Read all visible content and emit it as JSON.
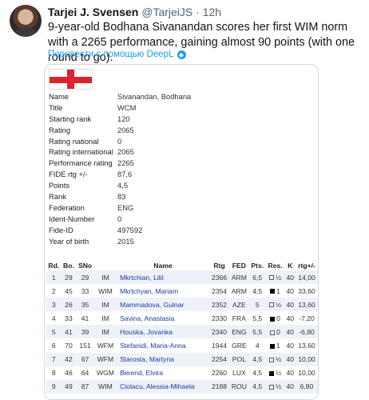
{
  "author": {
    "name": "Tarjei J. Svensen",
    "handle": "@TarjeiJS",
    "separator": "·",
    "time": "12h"
  },
  "tweet_text": "9-year-old Bodhana Sivanandan scores her first WIM norm with a 2265 performance, gaining almost 90 points (with one round to go).",
  "translate_label": "Перевести с помощью DeepL",
  "player_info": [
    {
      "label": "Name",
      "value": "Sivanandan, Bodhana"
    },
    {
      "label": "Title",
      "value": "WCM"
    },
    {
      "label": "Starting rank",
      "value": "120"
    },
    {
      "label": "Rating",
      "value": "2065"
    },
    {
      "label": "Rating national",
      "value": "0"
    },
    {
      "label": "Rating international",
      "value": "2065"
    },
    {
      "label": "Performance rating",
      "value": "2265"
    },
    {
      "label": "FIDE rtg +/-",
      "value": "87,6"
    },
    {
      "label": "Points",
      "value": "4,5"
    },
    {
      "label": "Rank",
      "value": "83"
    },
    {
      "label": "Federation",
      "value": "ENG"
    },
    {
      "label": "Ident-Number",
      "value": "0"
    },
    {
      "label": "Fide-ID",
      "value": "497592"
    },
    {
      "label": "Year of birth",
      "value": "2015"
    }
  ],
  "results": {
    "headers": [
      "Rd.",
      "Bo.",
      "SNo",
      "",
      "Name",
      "Rtg",
      "FED",
      "Pts.",
      "Res.",
      "K",
      "rtg+/-"
    ],
    "rows": [
      {
        "rd": "1",
        "bo": "29",
        "sno": "29",
        "title": "IM",
        "name": "Mkrtchian, Lilit",
        "rtg": "2366",
        "fed": "ARM",
        "pts": "6,5",
        "color": "white",
        "res": "½",
        "k": "40",
        "diff": "14,00"
      },
      {
        "rd": "2",
        "bo": "45",
        "sno": "33",
        "title": "WIM",
        "name": "Mkrtchyan, Mariam",
        "rtg": "2354",
        "fed": "ARM",
        "pts": "4,5",
        "color": "black",
        "res": "1",
        "k": "40",
        "diff": "33,60"
      },
      {
        "rd": "3",
        "bo": "26",
        "sno": "35",
        "title": "IM",
        "name": "Mammadova, Gulnar",
        "rtg": "2352",
        "fed": "AZE",
        "pts": "5",
        "color": "white",
        "res": "½",
        "k": "40",
        "diff": "13,60"
      },
      {
        "rd": "4",
        "bo": "33",
        "sno": "41",
        "title": "IM",
        "name": "Savina, Anastasia",
        "rtg": "2330",
        "fed": "FRA",
        "pts": "5,5",
        "color": "black",
        "res": "0",
        "k": "40",
        "diff": "-7,20"
      },
      {
        "rd": "5",
        "bo": "41",
        "sno": "39",
        "title": "IM",
        "name": "Houska, Jovanka",
        "rtg": "2340",
        "fed": "ENG",
        "pts": "5,5",
        "color": "white",
        "res": "0",
        "k": "40",
        "diff": "-6,80"
      },
      {
        "rd": "6",
        "bo": "70",
        "sno": "151",
        "title": "WFM",
        "name": "Stefanidi, Maria-Anna",
        "rtg": "1944",
        "fed": "GRE",
        "pts": "4",
        "color": "black",
        "res": "1",
        "k": "40",
        "diff": "13,60"
      },
      {
        "rd": "7",
        "bo": "42",
        "sno": "67",
        "title": "WFM",
        "name": "Starosta, Martyna",
        "rtg": "2254",
        "fed": "POL",
        "pts": "4,5",
        "color": "white",
        "res": "½",
        "k": "40",
        "diff": "10,00"
      },
      {
        "rd": "8",
        "bo": "46",
        "sno": "64",
        "title": "WGM",
        "name": "Berend, Elvira",
        "rtg": "2260",
        "fed": "LUX",
        "pts": "4,5",
        "color": "black",
        "res": "½",
        "k": "40",
        "diff": "10,00"
      },
      {
        "rd": "9",
        "bo": "49",
        "sno": "87",
        "title": "WIM",
        "name": "Ciolacu, Alessia-Mihaela",
        "rtg": "2188",
        "fed": "ROU",
        "pts": "4,5",
        "color": "white",
        "res": "½",
        "k": "40",
        "diff": "6,80"
      }
    ]
  },
  "colors": {
    "link": "#1d9bf0",
    "name_link": "#1a3aa0",
    "flag_red": "#d9242f",
    "row_alt": "#eef2f8"
  }
}
